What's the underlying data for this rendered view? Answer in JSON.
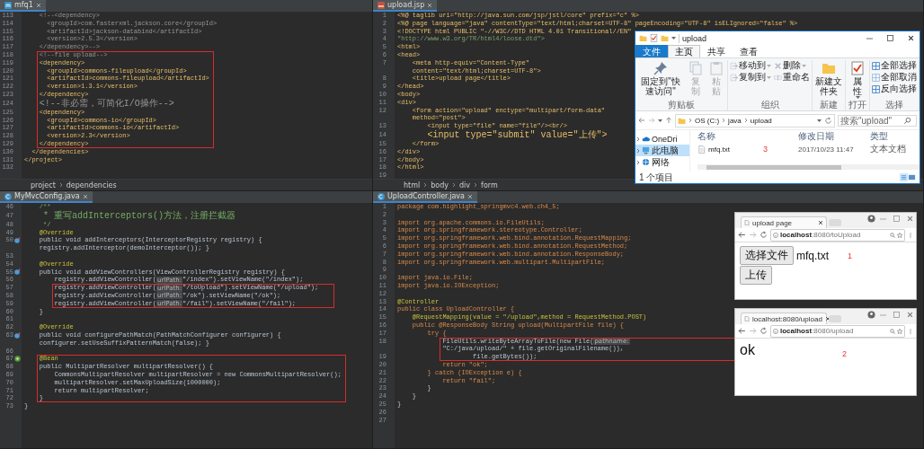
{
  "editors": [
    {
      "kind": "xml",
      "tab": "mfq1",
      "blocks": [
        {
          "highlighted": false,
          "lines": [
            {
              "number": "113",
              "kind": "comment",
              "text": "    <!--<dependency>"
            },
            {
              "number": "114",
              "kind": "comment",
              "text": "      <groupId>com.fasterxml.jackson.core</groupId>"
            },
            {
              "number": "115",
              "kind": "comment",
              "text": "      <artifactId>jackson-databind</artifactId>"
            },
            {
              "number": "116",
              "kind": "comment",
              "text": "      <version>2.5.3</version>"
            },
            {
              "number": "117",
              "kind": "comment",
              "text": "    </dependency>-->"
            }
          ]
        },
        {
          "highlighted": true,
          "lines": [
            {
              "number": "118",
              "kind": "comment",
              "text": "    <!--file upload-->"
            },
            {
              "number": "119",
              "kind": "markup",
              "text": "    <dependency>"
            },
            {
              "number": "120",
              "kind": "markup",
              "text": "      <groupId>commons-fileupload</groupId>"
            },
            {
              "number": "121",
              "kind": "markup",
              "text": "      <artifactId>commons-fileupload</artifactId>"
            },
            {
              "number": "122",
              "kind": "markup",
              "text": "      <version>1.3.1</version>"
            },
            {
              "number": "123",
              "kind": "markup",
              "text": "    </dependency>"
            },
            {
              "number": "124",
              "kind": "comment",
              "text": "    <!--非必需，可简化I/O操作-->"
            },
            {
              "number": "125",
              "kind": "markup",
              "text": "    <dependency>"
            },
            {
              "number": "126",
              "kind": "markup",
              "text": "      <groupId>commons-io</groupId>"
            },
            {
              "number": "127",
              "kind": "markup",
              "text": "      <artifactId>commons-io</artifactId>"
            },
            {
              "number": "128",
              "kind": "markup",
              "text": "      <version>2.3</version>"
            },
            {
              "number": "129",
              "kind": "markup",
              "text": "    </dependency>"
            }
          ]
        },
        {
          "highlighted": false,
          "lines": [
            {
              "number": "130",
              "kind": "markup",
              "text": "  </dependencies>"
            },
            {
              "number": "131",
              "kind": "markup",
              "text": "</project>"
            },
            {
              "number": "132",
              "kind": "code"
            }
          ]
        }
      ],
      "breadcrumb": [
        "project",
        "dependencies"
      ]
    },
    {
      "kind": "jsp",
      "tab": "upload.jsp",
      "blocks": [
        {
          "highlighted": false,
          "lines": [
            {
              "number": "1",
              "kind": "markup",
              "text": "<%@ taglib uri=\"http://java.sun.com/jsp/jstl/core\" prefix=\"c\" %>"
            },
            {
              "number": "2",
              "kind": "markup",
              "text": "<%@ page language=\"java\" contentType=\"text/html;charset=UTF-8\" pageEncoding=\"UTF-8\" isELIgnored=\"false\" %>"
            },
            {
              "number": "3",
              "kind": "markup",
              "text": "<!DOCTYPE html PUBLIC \"-//W3C//DTD HTML 4.01 Transitional//EN\""
            },
            {
              "number": "4",
              "kind": "string",
              "text": "\"http://www.w3.org/TR/html4/loose.dtd\">"
            },
            {
              "number": "5",
              "kind": "markup",
              "text": "<html>"
            },
            {
              "number": "6",
              "kind": "markup",
              "text": "<head>"
            },
            {
              "number": "7",
              "kind": "markup",
              "text": "    <meta http-equiv=\"Content-Type\" content=\"text/html;charset=UTF-8\">"
            },
            {
              "number": "8",
              "kind": "markup",
              "text": "    <title>upload page</title>"
            },
            {
              "number": "9",
              "kind": "markup",
              "text": "</head>"
            },
            {
              "number": "10",
              "kind": "markup",
              "text": "<body>"
            },
            {
              "number": "11",
              "kind": "markup",
              "text": "<div>"
            },
            {
              "number": "12",
              "kind": "markup",
              "text": "    <form action=\"upload\" enctype=\"multipart/form-data\" method=\"post\">"
            },
            {
              "number": "13",
              "kind": "markup",
              "text": "        <input type=\"file\" name=\"file\"/><br/>"
            },
            {
              "number": "14",
              "kind": "markup",
              "text": "        <input type=\"submit\" value=\"上传\">"
            },
            {
              "number": "15",
              "kind": "markup",
              "text": "    </form>"
            },
            {
              "number": "16",
              "kind": "markup",
              "text": "</div>"
            },
            {
              "number": "17",
              "kind": "markup",
              "text": "</body>"
            },
            {
              "number": "18",
              "kind": "markup",
              "text": "</html>"
            },
            {
              "number": "19",
              "kind": "code"
            }
          ]
        }
      ],
      "breadcrumb": [
        "html",
        "body",
        "div",
        "form"
      ]
    },
    {
      "kind": "java",
      "tab": "MyMvcConfig.java",
      "blocks": [
        {
          "highlighted": false,
          "lines": [
            {
              "number": "46",
              "kind": "javadoc",
              "text": "    /**"
            },
            {
              "number": "47",
              "kind": "javadoc",
              "text": "     * 重写addInterceptors()方法，注册拦截器"
            },
            {
              "number": "48",
              "kind": "javadoc",
              "text": "     */"
            },
            {
              "number": "49",
              "kind": "annotation",
              "text": "    @Override"
            },
            {
              "number": "50",
              "kind": "code",
              "gutter_mark": {
                "kind": "override"
              },
              "text": "    public void addInterceptors(InterceptorRegistry registry) { registry.addInterceptor(demoInterceptor()); }"
            },
            {
              "number": "53",
              "kind": "code"
            },
            {
              "number": "54",
              "kind": "annotation",
              "text": "    @Override"
            },
            {
              "number": "55",
              "kind": "code",
              "gutter_mark": {
                "kind": "override"
              },
              "text": "    public void addViewControllers(ViewControllerRegistry registry) {"
            },
            {
              "number": "56",
              "kind": "code",
              "text": "        registry.addViewController(",
              "hint": "urlPath:",
              "after": "\"/index\").setViewName(\"/index\");"
            }
          ]
        },
        {
          "highlighted": true,
          "lines": [
            {
              "number": "57",
              "kind": "code",
              "text": "        registry.addViewController(",
              "hint": "urlPath:",
              "after": "\"/toUpload\").setViewName(\"/upload\");"
            },
            {
              "number": "58",
              "kind": "code",
              "text": "        registry.addViewController(",
              "hint": "urlPath:",
              "after": "\"/ok\").setViewName(\"/ok\");"
            },
            {
              "number": "59",
              "kind": "code",
              "text": "        registry.addViewController(",
              "hint": "urlPath:",
              "after": "\"/fail\").setViewName(\"/fail\");"
            }
          ]
        },
        {
          "highlighted": false,
          "lines": [
            {
              "number": "60",
              "kind": "code",
              "text": "    }"
            },
            {
              "number": "61",
              "kind": "code"
            },
            {
              "number": "62",
              "kind": "annotation",
              "text": "    @Override"
            },
            {
              "number": "63",
              "kind": "code",
              "gutter_mark": {
                "kind": "override"
              },
              "text": "    public void configurePathMatch(PathMatchConfigurer configurer) { configurer.setUseSuffixPatternMatch(false); }"
            },
            {
              "number": "66",
              "kind": "code"
            }
          ]
        },
        {
          "highlighted": true,
          "lines": [
            {
              "number": "67",
              "kind": "annotation",
              "gutter_mark": {
                "kind": "bean"
              },
              "text": "    @Bean"
            },
            {
              "number": "68",
              "kind": "code",
              "text": "    public MultipartResolver multipartResolver() {"
            },
            {
              "number": "69",
              "kind": "code",
              "text": "        CommonsMultipartResolver multipartResolver = new CommonsMultipartResolver();"
            },
            {
              "number": "70",
              "kind": "code",
              "text": "        multipartResolver.setMaxUploadSize(1000000);"
            },
            {
              "number": "71",
              "kind": "code",
              "text": "        return multipartResolver;"
            },
            {
              "number": "72",
              "kind": "code",
              "text": "    }"
            }
          ]
        },
        {
          "highlighted": false,
          "lines": [
            {
              "number": "73",
              "kind": "code",
              "text": "}"
            }
          ]
        }
      ]
    },
    {
      "kind": "java",
      "tab": "UploadController.java",
      "blocks": [
        {
          "highlighted": false,
          "lines": [
            {
              "number": "1",
              "kind": "keyword",
              "text": "package com.highlight_springmvc4.web.ch4_5;"
            },
            {
              "number": "2",
              "kind": "code"
            },
            {
              "number": "3",
              "kind": "keyword",
              "text": "import org.apache.commons.io.FileUtils;"
            },
            {
              "number": "4",
              "kind": "keyword",
              "text": "import org.springframework.stereotype.Controller;"
            },
            {
              "number": "5",
              "kind": "keyword",
              "text": "import org.springframework.web.bind.annotation.RequestMapping;"
            },
            {
              "number": "6",
              "kind": "keyword",
              "text": "import org.springframework.web.bind.annotation.RequestMethod;"
            },
            {
              "number": "7",
              "kind": "keyword",
              "text": "import org.springframework.web.bind.annotation.ResponseBody;"
            },
            {
              "number": "8",
              "kind": "keyword",
              "text": "import org.springframework.web.multipart.MultipartFile;"
            },
            {
              "number": "9",
              "kind": "code"
            },
            {
              "number": "10",
              "kind": "keyword",
              "text": "import java.io.File;"
            },
            {
              "number": "11",
              "kind": "keyword",
              "text": "import java.io.IOException;"
            },
            {
              "number": "12",
              "kind": "code"
            },
            {
              "number": "13",
              "kind": "annotation",
              "text": "@Controller"
            },
            {
              "number": "14",
              "kind": "keyword",
              "text": "public class UploadController {"
            },
            {
              "number": "15",
              "kind": "annotation",
              "text": "    @RequestMapping(value = \"/upload\",method = RequestMethod.POST)"
            },
            {
              "number": "16",
              "kind": "keyword",
              "text": "    public @ResponseBody String upload(MultipartFile file) {"
            },
            {
              "number": "17",
              "kind": "keyword",
              "text": "        try {"
            }
          ]
        },
        {
          "highlighted": true,
          "lines": [
            {
              "number": "18",
              "kind": "code",
              "text": "            FileUtils.writeByteArrayToFile(new File(",
              "hint": "pathname:",
              "after": "\"C:/java/upload/\" + file.getOriginalFilename()),"
            },
            {
              "number": "19",
              "kind": "code",
              "text": "                    file.getBytes());"
            }
          ]
        },
        {
          "highlighted": false,
          "lines": [
            {
              "number": "20",
              "kind": "keyword",
              "text": "            return \"ok\";"
            },
            {
              "number": "21",
              "kind": "keyword",
              "text": "        } catch (IOException e) {"
            },
            {
              "number": "22",
              "kind": "keyword",
              "text": "            return \"fail\";"
            },
            {
              "number": "23",
              "kind": "code",
              "text": "        }"
            },
            {
              "number": "24",
              "kind": "code",
              "text": "    }"
            },
            {
              "number": "25",
              "kind": "code",
              "text": "}"
            },
            {
              "number": "26",
              "kind": "code"
            },
            {
              "number": "27",
              "kind": "code"
            }
          ]
        }
      ]
    }
  ],
  "file_explorer": {
    "title": "upload",
    "ribbon_tabs": [
      {
        "label": "文件",
        "kind": "menu",
        "selected": false
      },
      {
        "label": "主页",
        "kind": "tab",
        "selected": true
      },
      {
        "label": "共享",
        "kind": "tab",
        "selected": false
      },
      {
        "label": "查看",
        "kind": "tab",
        "selected": false
      }
    ],
    "ribbon_groups": [
      {
        "label": "剪贴板",
        "commands": [
          {
            "label": "固定到\"快速访问\"",
            "kind": "pin",
            "disabled": false,
            "dropdown": false
          },
          {
            "label": "复制",
            "kind": "copy",
            "disabled": true,
            "dropdown": false
          },
          {
            "label": "粘贴",
            "kind": "paste",
            "disabled": true,
            "dropdown": false
          }
        ]
      },
      {
        "label": "组织",
        "commands": [
          {
            "label": "移动到",
            "kind": "move_to",
            "disabled": true,
            "dropdown": true
          },
          {
            "label": "复制到",
            "kind": "copy_to",
            "disabled": true,
            "dropdown": true
          },
          {
            "label": "删除",
            "kind": "delete",
            "disabled": true,
            "dropdown": true
          },
          {
            "label": "重命名",
            "kind": "rename",
            "disabled": true,
            "dropdown": false
          }
        ]
      },
      {
        "label": "新建",
        "commands": [
          {
            "label": "新建文件夹",
            "kind": "new_folder",
            "disabled": false,
            "dropdown": false
          }
        ]
      },
      {
        "label": "打开",
        "commands": [
          {
            "label": "属性",
            "kind": "properties",
            "disabled": false,
            "dropdown": true
          }
        ]
      },
      {
        "label": "选择",
        "commands": [
          {
            "label": "全部选择",
            "kind": "select_all",
            "disabled": false,
            "dropdown": false
          },
          {
            "label": "全部取消",
            "kind": "select_none",
            "disabled": true,
            "dropdown": false
          },
          {
            "label": "反向选择",
            "kind": "invert_selection",
            "disabled": false,
            "dropdown": false
          }
        ]
      }
    ],
    "address": [
      "OS (C:)",
      "java",
      "upload"
    ],
    "search": {
      "placeholder": "搜索\"upload\""
    },
    "nav": [
      {
        "label": "OneDri",
        "kind": "cloud",
        "selected": false
      },
      {
        "label": "此电脑",
        "kind": "computer",
        "selected": true
      },
      {
        "label": "网络",
        "kind": "network",
        "selected": false
      }
    ],
    "columns": [
      "名称",
      "修改日期",
      "类型"
    ],
    "rows": [
      {
        "name": "mfq.txt",
        "annotation": "3",
        "modified": "2017/10/23 11:47",
        "type": "文本文档"
      }
    ],
    "status": "1 个项目"
  },
  "browsers": [
    {
      "tab": "upload page",
      "url": "**localhost**:8080/toUpload",
      "content": {
        "kind": "upload_form",
        "choose_button": "选择文件",
        "file_name": "mfq.txt",
        "annotation": "1",
        "submit_button": "上传"
      }
    },
    {
      "tab": "localhost:8080/upload",
      "url": "**localhost**:8080/upload",
      "content": {
        "kind": "text",
        "text": "ok",
        "annotation": "2"
      }
    }
  ]
}
